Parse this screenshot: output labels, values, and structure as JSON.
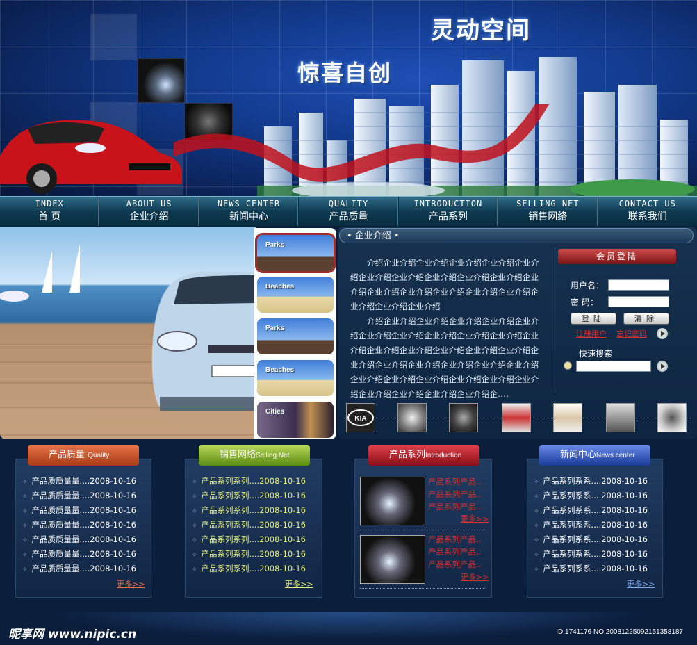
{
  "banner": {
    "slogan_main": "灵动空间",
    "slogan_sub": "惊喜自创"
  },
  "nav": [
    {
      "en": "INDEX",
      "cn": "首  页"
    },
    {
      "en": "ABOUT US",
      "cn": "企业介绍"
    },
    {
      "en": "NEWS CENTER",
      "cn": "新闻中心"
    },
    {
      "en": "QUALITY",
      "cn": "产品质量"
    },
    {
      "en": "INTRODUCTION",
      "cn": "产品系列"
    },
    {
      "en": "SELLING NET",
      "cn": "销售网络"
    },
    {
      "en": "CONTACT US",
      "cn": "联系我们"
    }
  ],
  "gallery": {
    "items": [
      {
        "label": "Parks"
      },
      {
        "label": "Beaches"
      },
      {
        "label": "Parks"
      },
      {
        "label": "Beaches"
      },
      {
        "label": "Cities"
      }
    ]
  },
  "intro": {
    "title": "• 企业介绍 •",
    "para1": "介绍企业介绍企业介绍企业介绍企业介绍企业介绍企业介绍企业介绍企业介绍企业介绍企业介绍企业介绍企业介绍企业介绍企业介绍企业介绍企业介绍企业介绍企业介绍企业介绍",
    "para2": "介绍企业介绍企业介绍企业介绍企业介绍企业介绍企业介绍企业介绍企业介绍企业介绍企业介绍企业介绍企业介绍企业介绍企业介绍企业介绍企业介绍企业介绍企业介绍企业介绍企业介绍企业介绍企业介绍企业介绍企业介绍企业介绍企业介绍企业介绍企业介绍企业介绍企业介绍企业介绍企业介绍企...."
  },
  "login": {
    "title": "会员登陆",
    "username_label": "用户名：",
    "password_label": "密  码：",
    "login_btn": "登陆",
    "clear_btn": "清除",
    "register": "注册用户",
    "forgot": "忘记密码",
    "search_label": "快速搜索"
  },
  "logos": [
    "KIA"
  ],
  "panels": {
    "quality": {
      "title": "产品质量",
      "title_en": "Quality",
      "items": [
        "产品质质量量....2008-10-16",
        "产品质质量量....2008-10-16",
        "产品质质量量....2008-10-16",
        "产品质质量量....2008-10-16",
        "产品质质量量....2008-10-16",
        "产品质质量量....2008-10-16",
        "产品质质量量....2008-10-16"
      ],
      "more": "更多>>"
    },
    "selling": {
      "title": "销售网络",
      "title_en": "Selling Net",
      "items": [
        "产品系列系列....2008-10-16",
        "产品系列系列....2008-10-16",
        "产品系列系列....2008-10-16",
        "产品系列系列....2008-10-16",
        "产品系列系列....2008-10-16",
        "产品系列系列....2008-10-16",
        "产品系列系列....2008-10-16"
      ],
      "more": "更多>>"
    },
    "series": {
      "title": "产品系列",
      "title_en": "Introduction",
      "products": [
        {
          "lines": [
            "产品系列产品..",
            "产品系列产品..",
            "产品系列产品.."
          ],
          "more": "更多>>"
        },
        {
          "lines": [
            "产品系列产品..",
            "产品系列产品..",
            "产品系列产品.."
          ],
          "more": "更多>>"
        }
      ]
    },
    "news": {
      "title": "新闻中心",
      "title_en": "News center",
      "items": [
        "产品系列系系....2008-10-16",
        "产品系列系系....2008-10-16",
        "产品系列系系....2008-10-16",
        "产品系列系系....2008-10-16",
        "产品系列系系....2008-10-16",
        "产品系列系系....2008-10-16",
        "产品系列系系....2008-10-16"
      ],
      "more": "更多>>"
    }
  },
  "footer": {
    "watermark_left": "昵享网 www.nipic.cn",
    "watermark_right": "ID:1741176 NO:20081225092151358187"
  }
}
